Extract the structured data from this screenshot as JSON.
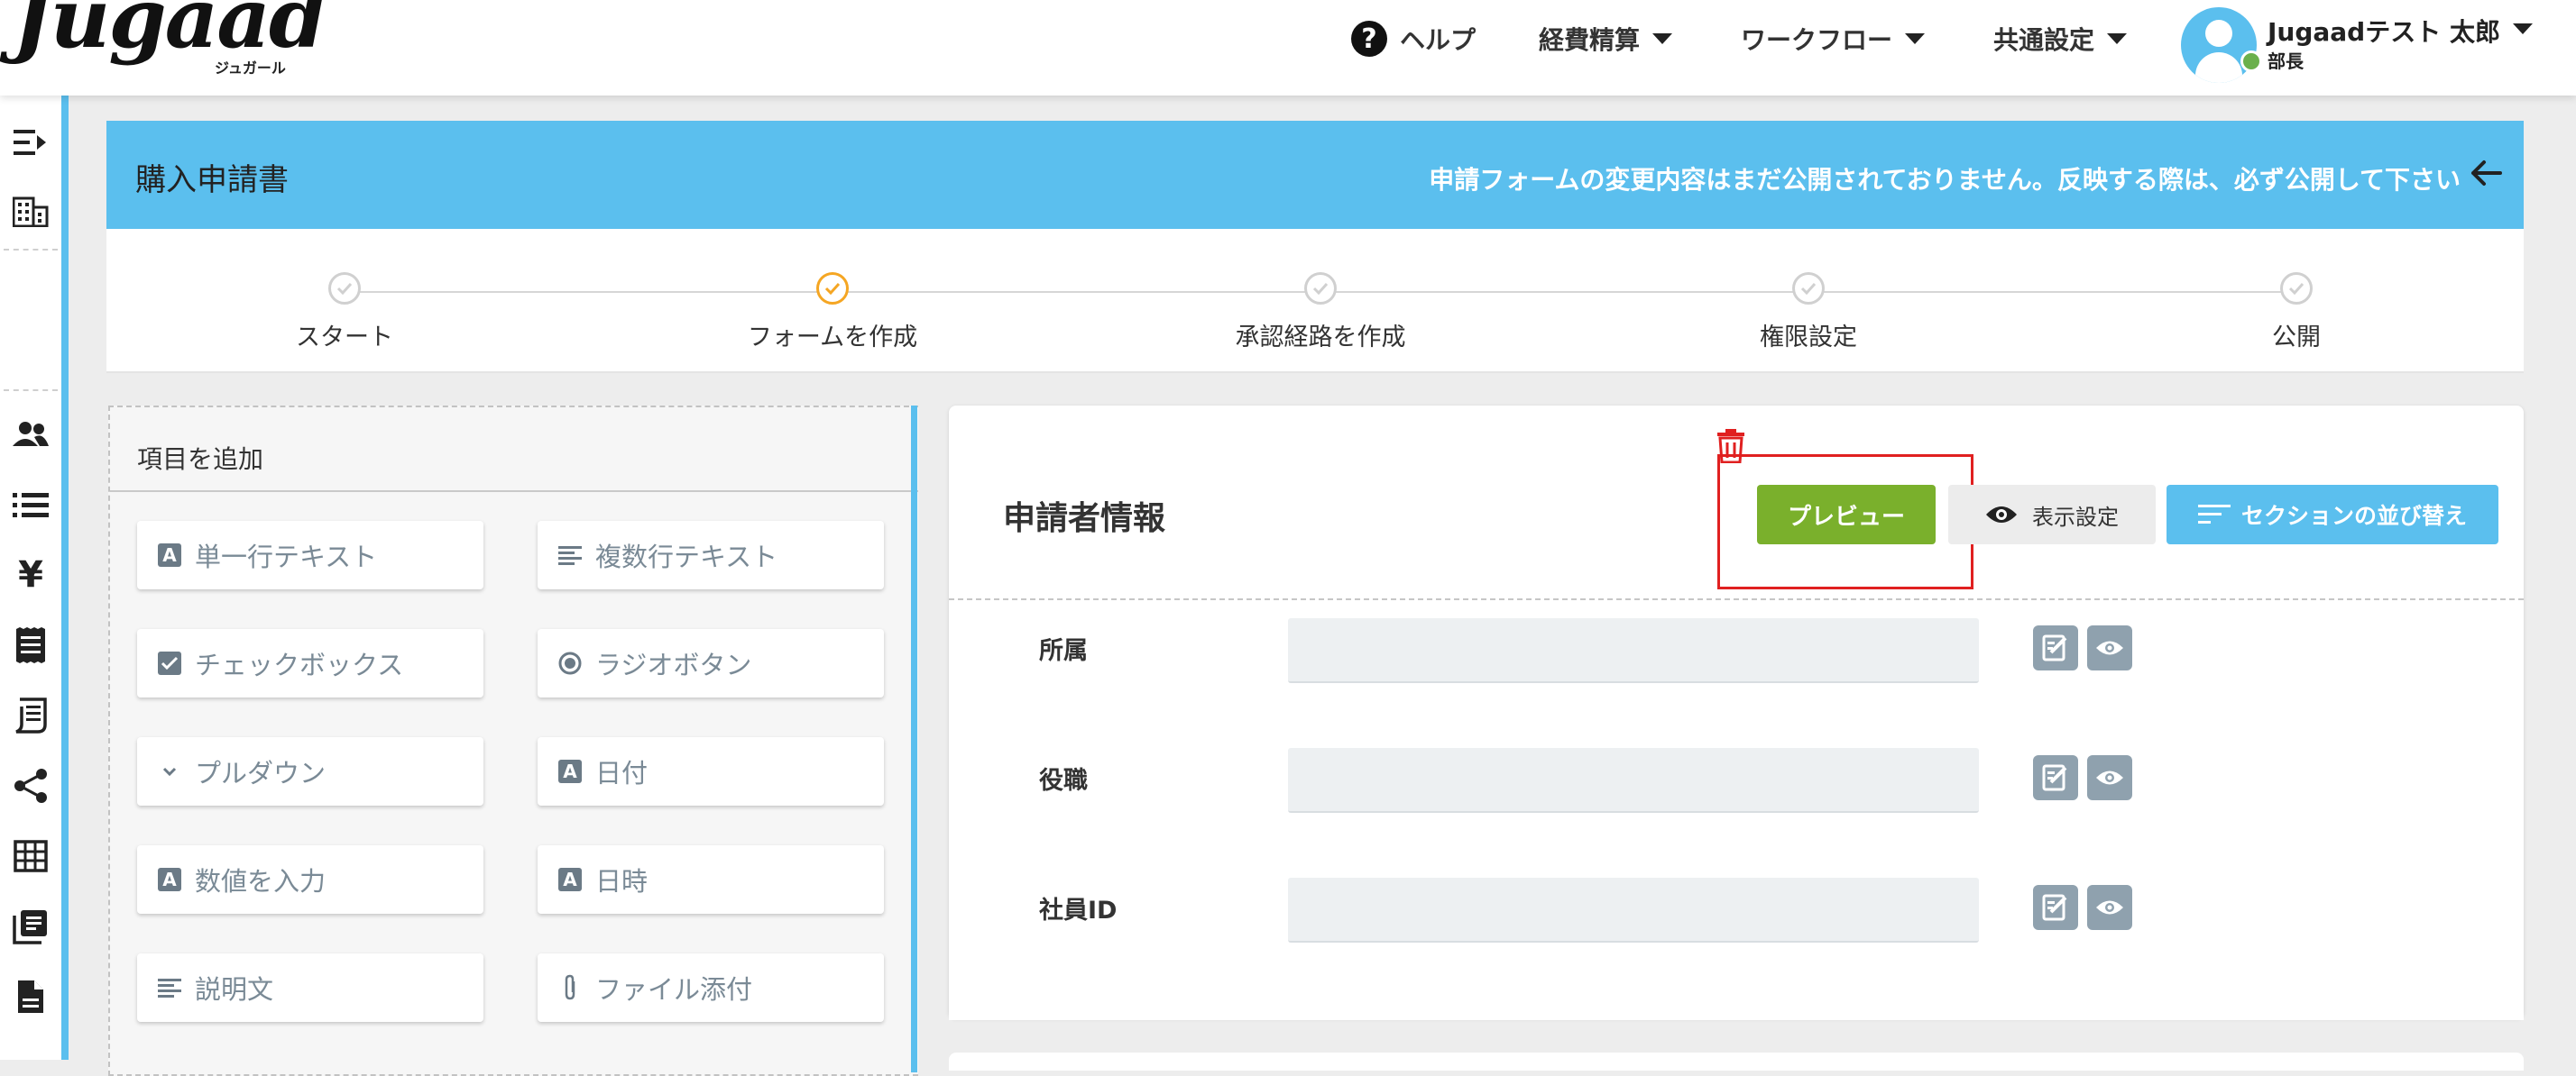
{
  "header": {
    "logo_text": "Jugaad",
    "logo_sub": "ジュガール",
    "nav": {
      "help": "ヘルプ",
      "expense": "経費精算",
      "workflow": "ワークフロー",
      "common": "共通設定"
    },
    "user": {
      "name": "Jugaadテスト 太郎",
      "role": "部長"
    }
  },
  "sidebar": {
    "icons": [
      "menu-expand-icon",
      "building-icon",
      "people-icon",
      "list-icon",
      "yen-icon",
      "receipt-icon",
      "document-list-icon",
      "share-icon",
      "table-icon",
      "library-icon",
      "file-icon"
    ]
  },
  "banner": {
    "title": "購入申請書",
    "message": "申請フォームの変更内容はまだ公開されておりません。反映する際は、必ず公開して下さい"
  },
  "steps": [
    {
      "label": "スタート",
      "state": "pending"
    },
    {
      "label": "フォームを作成",
      "state": "active"
    },
    {
      "label": "承認経路を作成",
      "state": "pending"
    },
    {
      "label": "権限設定",
      "state": "pending"
    },
    {
      "label": "公開",
      "state": "pending"
    }
  ],
  "add_panel": {
    "title": "項目を追加",
    "buttons": [
      {
        "label": "単一行テキスト",
        "icon": "text-box-icon"
      },
      {
        "label": "複数行テキスト",
        "icon": "multiline-icon"
      },
      {
        "label": "チェックボックス",
        "icon": "checkbox-icon"
      },
      {
        "label": "ラジオボタン",
        "icon": "radio-icon"
      },
      {
        "label": "プルダウン",
        "icon": "chevron-down-icon"
      },
      {
        "label": "日付",
        "icon": "text-box-icon"
      },
      {
        "label": "数値を入力",
        "icon": "text-box-icon"
      },
      {
        "label": "日時",
        "icon": "text-box-icon"
      },
      {
        "label": "説明文",
        "icon": "multiline-icon"
      },
      {
        "label": "ファイル添付",
        "icon": "paperclip-icon"
      }
    ]
  },
  "section": {
    "title": "申請者情報",
    "buttons": {
      "preview": "プレビュー",
      "display_settings": "表示設定",
      "sort": "セクションの並び替え"
    },
    "fields": [
      {
        "label": "所属",
        "value": ""
      },
      {
        "label": "役職",
        "value": ""
      },
      {
        "label": "社員ID",
        "value": ""
      }
    ]
  },
  "colors": {
    "accent": "#5bbfee",
    "preview_green": "#7ab02c",
    "active_step": "#f5a623",
    "highlight_red": "#e02020"
  }
}
